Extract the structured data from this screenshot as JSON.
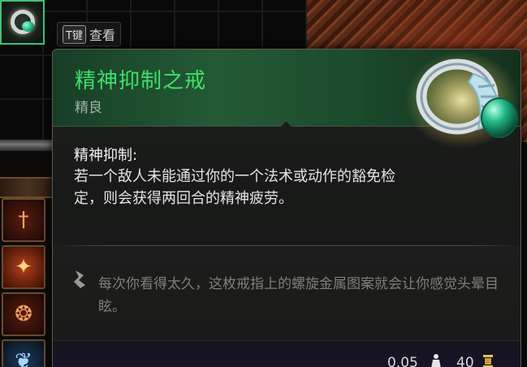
{
  "hotkey_hint": {
    "key": "T键",
    "action": "查看"
  },
  "tooltip": {
    "item_name": "精神抑制之戒",
    "rarity": "精良",
    "ability_title": "精神抑制:",
    "ability_description": "若一个敌人未能通过你的一个法术或动作的豁免检定，则会获得两回合的精神疲劳。",
    "lore": "每次你看得太久，这枚戒指上的螺旋金属图案就会让你感觉头晕目眩。",
    "weight": "0.05",
    "price": "40"
  },
  "colors": {
    "item_name": "#3fe06a",
    "rarity": "#9fb0a3",
    "selected_slot_border": "#3ec27a",
    "lore_text": "#7f7f7a"
  },
  "icons": {
    "selected_slot": "ring-icon",
    "quote": "quote-icon",
    "weight": "weight-icon",
    "price": "gold-coin-icon",
    "skill_slots": [
      "sword-icon",
      "fire-strike-icon",
      "horn-icon",
      "feather-icon"
    ]
  }
}
